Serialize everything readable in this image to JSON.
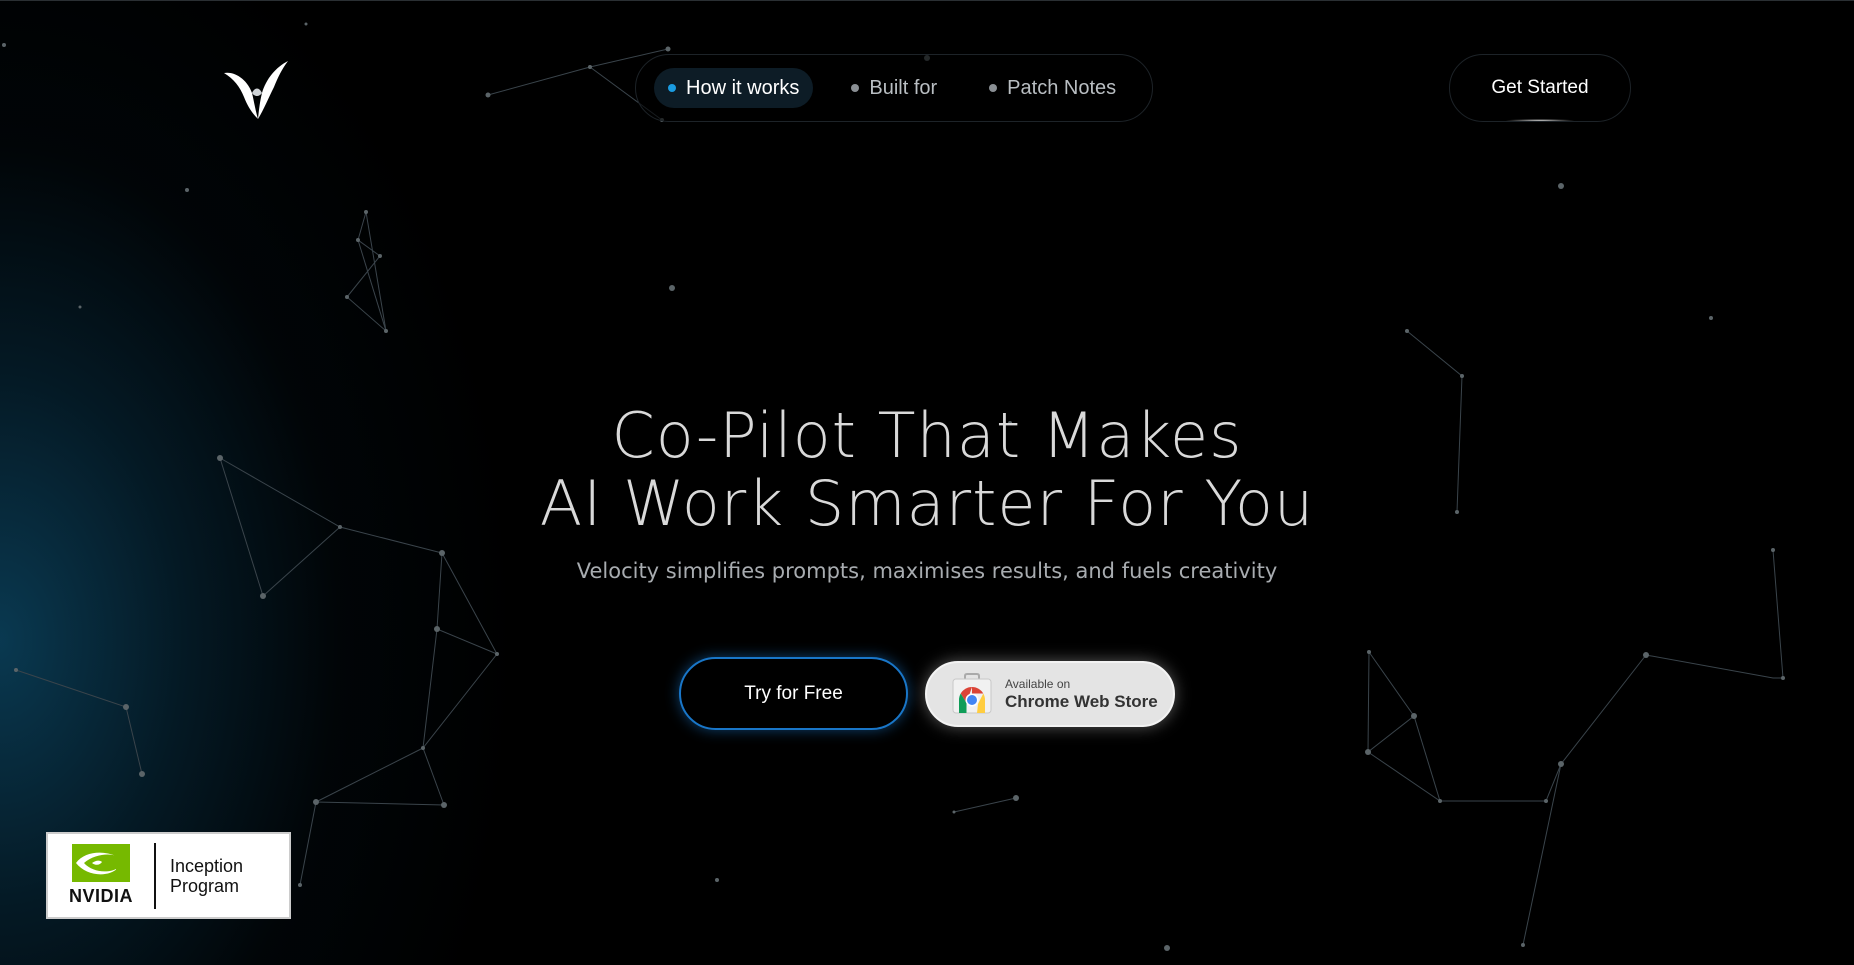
{
  "nav": {
    "items": [
      {
        "label": "How it works",
        "active": true
      },
      {
        "label": "Built for",
        "active": false
      },
      {
        "label": "Patch Notes",
        "active": false
      }
    ],
    "cta_label": "Get Started"
  },
  "hero": {
    "title_line1": "Co-Pilot That Makes",
    "title_line2": "AI Work Smarter For You",
    "subtitle": "Velocity simplifies prompts, maximises results, and fuels creativity"
  },
  "buttons": {
    "try_label": "Try for Free",
    "store_small": "Available on",
    "store_big": "Chrome Web Store"
  },
  "badge": {
    "brand": "NVIDIA",
    "line1": "Inception",
    "line2": "Program"
  },
  "colors": {
    "accent_blue": "#1976c8",
    "active_dot": "#1a9be0",
    "nvidia_green": "#76b900"
  },
  "icons": {
    "logo": "velocity-bird-logo",
    "store": "chrome-web-store-icon",
    "nvidia": "nvidia-eye-icon"
  }
}
